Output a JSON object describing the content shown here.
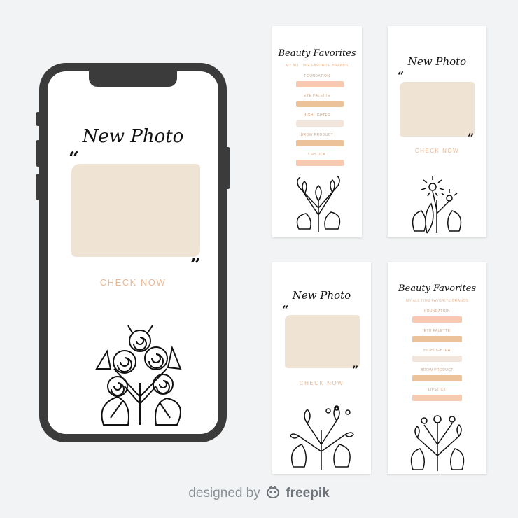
{
  "colors": {
    "accent": "#e8b896",
    "blob": "#efe3d4",
    "stroke_peach": "#f6c9b0",
    "stroke_tan": "#ecc29a",
    "stroke_light": "#f2e6dc"
  },
  "phone": {
    "title": "New Photo",
    "open_quote": "“",
    "close_quote": "”",
    "cta": "CHECK NOW"
  },
  "story_new_photo": {
    "title": "New Photo",
    "open_quote": "“",
    "close_quote": "”",
    "cta": "CHECK NOW"
  },
  "story_beauty": {
    "title": "Beauty Favorites",
    "subtitle": "MY ALL TIME FAVORITE BRANDS",
    "items": [
      "FOUNDATION",
      "EYE PALETTE",
      "HIGHLIGHTER",
      "BROW PRODUCT",
      "LIPSTICK"
    ]
  },
  "watermark": {
    "prefix": "designed by",
    "brand": "freepik",
    "icon": "freepik-logo-icon"
  }
}
